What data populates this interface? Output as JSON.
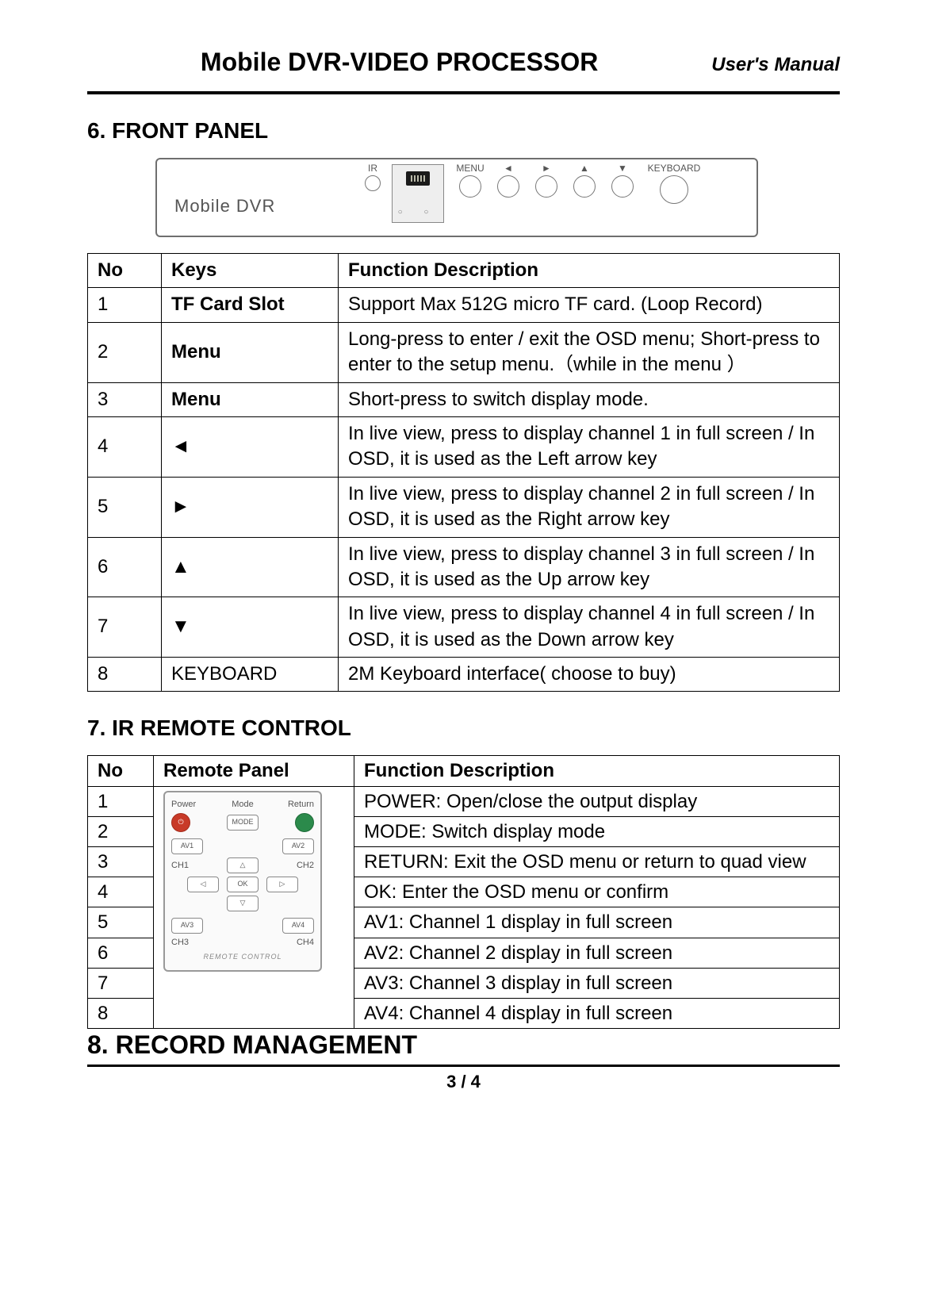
{
  "header": {
    "title": "Mobile DVR-VIDEO PROCESSOR",
    "subtitle": "User's Manual"
  },
  "section6": {
    "heading": "6.   FRONT PANEL",
    "panel": {
      "brand": "Mobile  DVR",
      "ir_label": "IR",
      "buttons": {
        "menu": "MENU",
        "left": "◄",
        "right": "►",
        "up": "▲",
        "down": "▼",
        "keyboard": "KEYBOARD"
      }
    },
    "table": {
      "headers": {
        "no": "No",
        "keys": "Keys",
        "desc": "Function Description"
      },
      "rows": [
        {
          "no": "1",
          "keys": "TF Card Slot",
          "bold": true,
          "desc": "Support Max 512G micro TF card. (Loop Record)"
        },
        {
          "no": "2",
          "keys": "Menu",
          "bold": true,
          "desc": "Long-press to enter / exit the OSD menu; Short-press to enter to the setup menu.（while in the menu ）"
        },
        {
          "no": "3",
          "keys": "Menu",
          "bold": true,
          "desc": "Short-press to switch display mode."
        },
        {
          "no": "4",
          "keys": "◄",
          "bold": false,
          "desc": "In live view, press to display channel 1 in full screen / In OSD, it is used as the Left arrow key"
        },
        {
          "no": "5",
          "keys": "►",
          "bold": false,
          "desc": "In live view, press to display channel 2 in full screen / In OSD, it is used as the Right arrow key"
        },
        {
          "no": "6",
          "keys": "▲",
          "bold": false,
          "desc": "In live view, press to display channel 3 in full screen / In OSD, it is used as the Up arrow key"
        },
        {
          "no": "7",
          "keys": "▼",
          "bold": false,
          "desc": "In live view, press to display channel 4 in full screen / In OSD, it is used as the Down arrow key"
        },
        {
          "no": "8",
          "keys": "KEYBOARD",
          "bold": false,
          "desc": "2M Keyboard interface( choose to buy)"
        }
      ]
    }
  },
  "section7": {
    "heading": "7.   IR REMOTE CONTROL",
    "table": {
      "headers": {
        "no": "No",
        "remote": "Remote Panel",
        "desc": "Function Description"
      },
      "rows": [
        {
          "no": "1",
          "desc": "POWER: Open/close the output display"
        },
        {
          "no": "2",
          "desc": "MODE: Switch display mode"
        },
        {
          "no": "3",
          "desc": "RETURN: Exit the OSD menu or return to quad view",
          "justify": true
        },
        {
          "no": "4",
          "desc": "OK: Enter the OSD menu or confirm"
        },
        {
          "no": "5",
          "desc": "AV1: Channel 1 display in full screen"
        },
        {
          "no": "6",
          "desc": "AV2: Channel 2 display in full screen"
        },
        {
          "no": "7",
          "desc": "AV3: Channel 3 display in full screen"
        },
        {
          "no": "8",
          "desc": "AV4: Channel 4 display in full screen"
        }
      ]
    },
    "remote_labels": {
      "power": "Power",
      "mode": "Mode",
      "return": "Return",
      "mode_btn": "MODE",
      "av1": "AV1",
      "av2": "AV2",
      "av3": "AV3",
      "av4": "AV4",
      "ch1": "CH1",
      "ch2": "CH2",
      "ch3": "CH3",
      "ch4": "CH4",
      "ok": "OK",
      "footer": "REMOTE CONTROL"
    }
  },
  "section8": {
    "heading": "8.   RECORD MANAGEMENT"
  },
  "footer": {
    "page": "3 / 4"
  }
}
